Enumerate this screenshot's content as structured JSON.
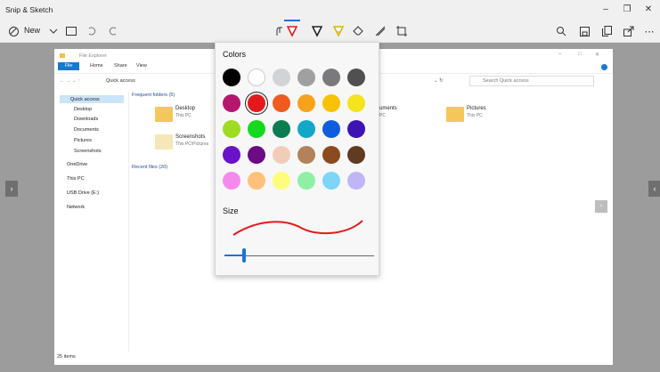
{
  "app": {
    "title": "Snip & Sketch",
    "new_label": "New"
  },
  "window_controls": {
    "minimize": "–",
    "maximize": "❐",
    "close": "✕"
  },
  "toolbar": {
    "more": "⋯"
  },
  "color_panel": {
    "title": "Colors",
    "size_title": "Size",
    "selected_color": "#e4191c",
    "accent": "#1e73d6",
    "swatches": [
      "#000000",
      "#ffffff",
      "#d1d3d4",
      "#a0a0a0",
      "#7a7a7c",
      "#505050",
      "#b5176e",
      "#e4191c",
      "#f05a1e",
      "#f7a21b",
      "#f7c300",
      "#f5e31c",
      "#9edc24",
      "#16d81e",
      "#0b7d50",
      "#12a7c8",
      "#0e5de0",
      "#3d14b4",
      "#6a12c9",
      "#6c0b83",
      "#f1cdb9",
      "#b3825b",
      "#8c4a1f",
      "#623a22",
      "#f48bec",
      "#ffc07a",
      "#fdfd7c",
      "#8ff0a4",
      "#7fd4f8",
      "#beb6f6"
    ],
    "pen_size_fraction": 0.13
  },
  "explorer": {
    "title": "File Explorer",
    "ribbon_file": "File",
    "ribbon_home": "Home",
    "ribbon_share": "Share",
    "ribbon_view": "View",
    "address": "Quick access",
    "search_placeholder": "Search Quick access",
    "nav_items": [
      "Quick access",
      "Desktop",
      "Downloads",
      "Documents",
      "Pictures",
      "Screenshots",
      "OneDrive",
      "This PC",
      "USB Drive (E:)",
      "Network"
    ],
    "frequent_header": "Frequent folders (5)",
    "recent_header": "Recent files (20)",
    "tiles": [
      {
        "name": "Desktop",
        "sub": "This PC"
      },
      {
        "name": "Screenshots",
        "sub": "This PC\\Pictures"
      },
      {
        "name": "uments",
        "sub": "PC"
      },
      {
        "name": "Pictures",
        "sub": "This PC"
      }
    ],
    "status": "25 items"
  }
}
